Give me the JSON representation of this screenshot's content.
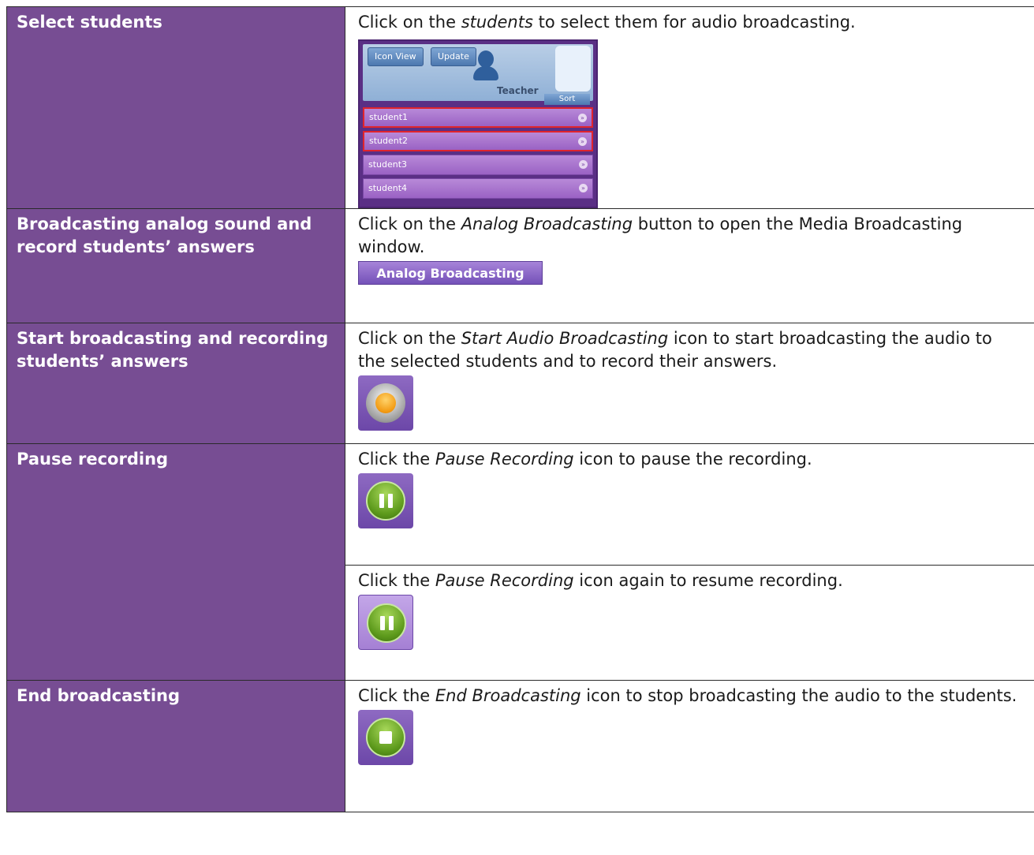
{
  "rows": [
    {
      "label": "Select students",
      "text_before": "Click on the ",
      "text_em": "students",
      "text_after": " to select them for audio broadcasting.",
      "screenshot": {
        "icon_view_label": "Icon View",
        "update_label": "Update",
        "teacher_label": "Teacher",
        "sort_label": "Sort",
        "students": [
          {
            "name": "student1",
            "selected": true
          },
          {
            "name": "student2",
            "selected": true
          },
          {
            "name": "student3",
            "selected": false
          },
          {
            "name": "student4",
            "selected": false
          }
        ]
      }
    },
    {
      "label": "Broadcasting analog sound and record students’ answers",
      "text_before": "Click on the ",
      "text_em": "Analog Broadcasting",
      "text_after": " button to open the Media Broadcasting window.",
      "button_label": "Analog Broadcasting"
    },
    {
      "label": "Start broadcasting and recording students’ answers",
      "text_before": "Click on the ",
      "text_em": "Start Audio Broadcasting",
      "text_after": " icon to start broadcasting the audio to the selected students and to record their answers.",
      "icon": "record-icon"
    },
    {
      "label": "Pause recording",
      "text_before": "Click the ",
      "text_em": "Pause Recording",
      "text_after": " icon to pause the recording.",
      "icon": "pause-icon"
    },
    {
      "text_before": "Click the ",
      "text_em": "Pause Recording",
      "text_after": " icon again to resume recording.",
      "icon": "pause-icon"
    },
    {
      "label": "End broadcasting",
      "text_before": "Click the ",
      "text_em": "End Broadcasting",
      "text_after": " icon to stop broadcasting the audio to the students.",
      "icon": "stop-icon"
    }
  ],
  "colors": {
    "label_background": "#774d93",
    "label_text": "#ffffff",
    "selected_border": "#e0242d"
  }
}
